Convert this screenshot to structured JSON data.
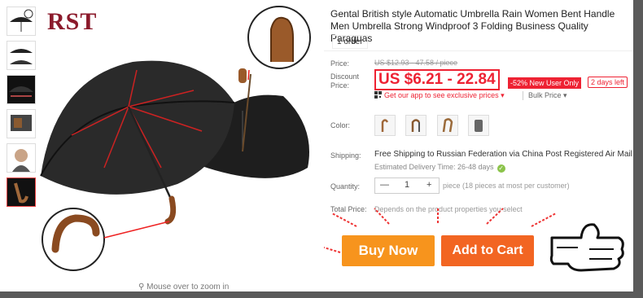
{
  "product": {
    "title": "Gental British style Automatic Umbrella Rain Women Bent Handle Men Umbrella Strong Windproof 3 Folding Business Quality Paraguas",
    "orders": "1 order"
  },
  "brand": {
    "logo_text": "RST"
  },
  "gallery": {
    "zoom_hint": "Mouse over to zoom in",
    "thumbnails": [
      "thumb-1",
      "thumb-2",
      "thumb-3",
      "thumb-4",
      "thumb-5",
      "thumb-6"
    ]
  },
  "pricing": {
    "price_label": "Price:",
    "original_price": "US $12.93 - 47.58 / piece",
    "discount_label": "Discount Price:",
    "discount_price": "US $6.21 - 22.84",
    "badge": "-52% New User Only",
    "days_left": "2 days left",
    "app_promo": "Get our app to see exclusive prices",
    "bulk_price": "Bulk Price"
  },
  "color": {
    "label": "Color:"
  },
  "shipping": {
    "label": "Shipping:",
    "text": "Free Shipping to Russian Federation via China Post Registered Air Mail",
    "estimated": "Estimated Delivery Time: 26-48 days"
  },
  "quantity": {
    "label": "Quantity:",
    "minus": "—",
    "value": "1",
    "plus": "+",
    "note": "piece (18 pieces at most per customer)"
  },
  "total": {
    "label": "Total Price:",
    "note": "Depends on the product properties you select"
  },
  "actions": {
    "buy_now": "Buy Now",
    "add_to_cart": "Add to Cart"
  },
  "colors": {
    "accent_red": "#e23",
    "buy_orange": "#f7941d",
    "cart_orange": "#f26522"
  }
}
